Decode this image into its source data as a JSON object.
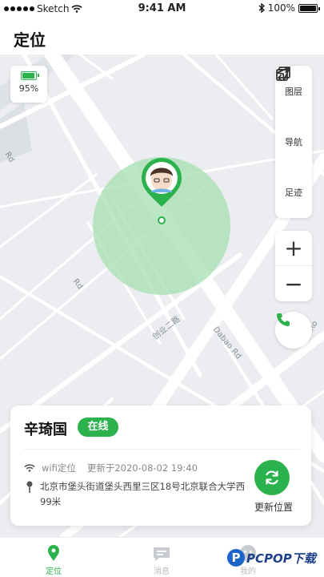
{
  "status_bar": {
    "carrier": "Sketch",
    "time": "9:41 AM",
    "battery": "100%"
  },
  "header": {
    "title": "定位"
  },
  "device_battery": {
    "percent": "95%",
    "level": 0.95
  },
  "map": {
    "road_labels": [
      "创业二路",
      "Dabao Rd",
      "Rd",
      "Rd",
      "st Ro"
    ],
    "tools": [
      {
        "icon": "layers-icon",
        "label": "图层"
      },
      {
        "icon": "navigation-icon",
        "label": "导航"
      },
      {
        "icon": "track-icon",
        "label": "足迹"
      }
    ],
    "zoom_in": "+",
    "zoom_out": "−"
  },
  "person": {
    "name": "辛琦国",
    "status": "在线",
    "location_source": "wifi定位",
    "updated": "更新于2020-08-02 19:40",
    "address": "北京市堡头街道堡头西里三区18号北京联合大学西99米",
    "update_label": "更新位置"
  },
  "tabs": [
    {
      "label": "定位",
      "active": true
    },
    {
      "label": "消息",
      "active": false
    },
    {
      "label": "我的",
      "active": false
    }
  ],
  "watermark": {
    "logo": "P",
    "text": "PCPOP下载"
  },
  "colors": {
    "accent": "#2bb24c",
    "map_bg": "#ebedf0",
    "circle": "#a8e0b4"
  }
}
